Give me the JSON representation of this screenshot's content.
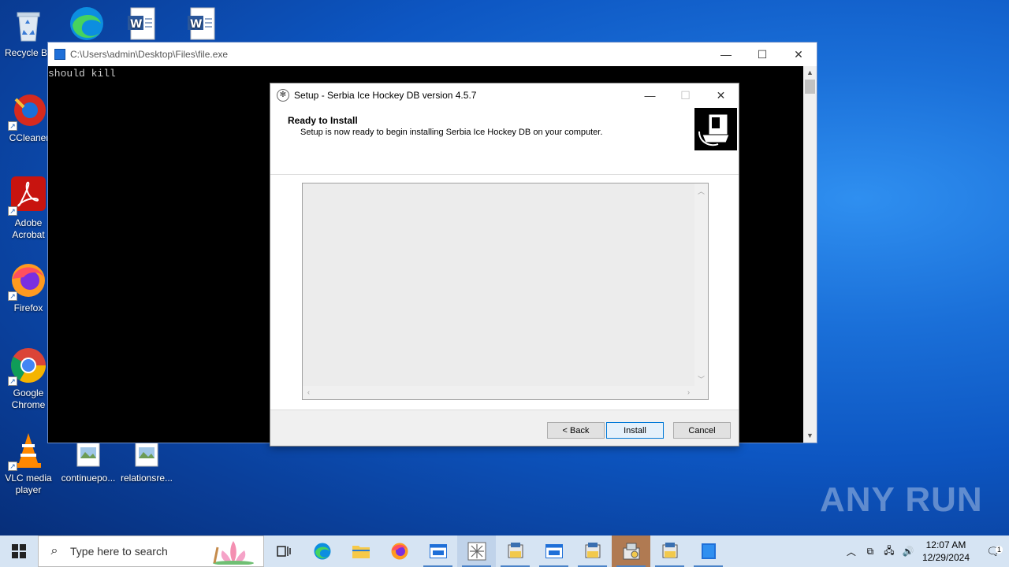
{
  "desktop": {
    "icons": [
      {
        "label": "Recycle Bin",
        "name": "recycle-bin"
      },
      {
        "label": "CCleaner",
        "name": "ccleaner"
      },
      {
        "label": "Adobe Acrobat",
        "name": "adobe-acrobat"
      },
      {
        "label": "Firefox",
        "name": "firefox"
      },
      {
        "label": "Google Chrome",
        "name": "google-chrome"
      },
      {
        "label": "VLC media player",
        "name": "vlc"
      },
      {
        "label": "continuepo...",
        "name": "continuepo"
      },
      {
        "label": "relationsre...",
        "name": "relationsre"
      }
    ],
    "top_labels": [
      "Recycle Bi",
      "CCleaner",
      "Adobe\nAcrobat",
      "Firefox",
      "Google\nChrome",
      "VLC media\nplayer",
      "continuepo...",
      "relationsre..."
    ]
  },
  "console": {
    "title": "C:\\Users\\admin\\Desktop\\Files\\file.exe",
    "output": "should kill"
  },
  "setup": {
    "title": "Setup - Serbia Ice Hockey DB version 4.5.7",
    "heading": "Ready to Install",
    "subheading": "Setup is now ready to begin installing Serbia Ice Hockey DB on your computer.",
    "buttons": {
      "back": "< Back",
      "install": "Install",
      "cancel": "Cancel"
    }
  },
  "watermark": "ANY RUN",
  "taskbar": {
    "search_placeholder": "Type here to search",
    "time": "12:07 AM",
    "date": "12/29/2024",
    "notification_count": "1"
  }
}
